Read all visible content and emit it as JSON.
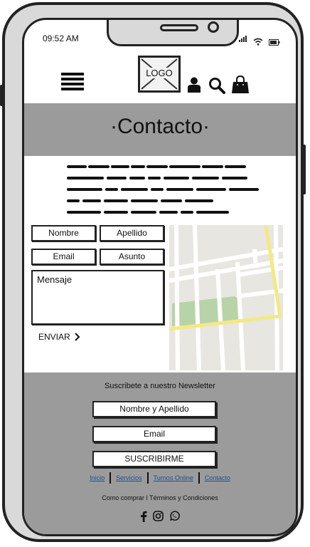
{
  "status_bar": {
    "time": "09:52 AM"
  },
  "header": {
    "logo_text": "LOGO"
  },
  "banner": {
    "title": "·Contacto·"
  },
  "form": {
    "nombre": "Nombre",
    "apellido": "Apellido",
    "email": "Email",
    "asunto": "Asunto",
    "mensaje": "Mensaje",
    "enviar": "ENVIAR"
  },
  "footer": {
    "newsletter_title": "Suscribete a nuestro Newsletter",
    "nombre_apellido": "Nombre y Apellido",
    "email": "Email",
    "subscribe_button": "SUSCRIBIRME",
    "links": [
      "Inicio",
      "Servicios",
      "Turnos Online",
      "Contacto"
    ],
    "legal": "Como comprar   I Términos y Condiciones"
  },
  "icons": [
    "hamburger-icon",
    "user-icon",
    "search-icon",
    "shopping-bag-icon",
    "chevron-right-icon",
    "facebook-icon",
    "instagram-icon",
    "whatsapp-icon"
  ]
}
